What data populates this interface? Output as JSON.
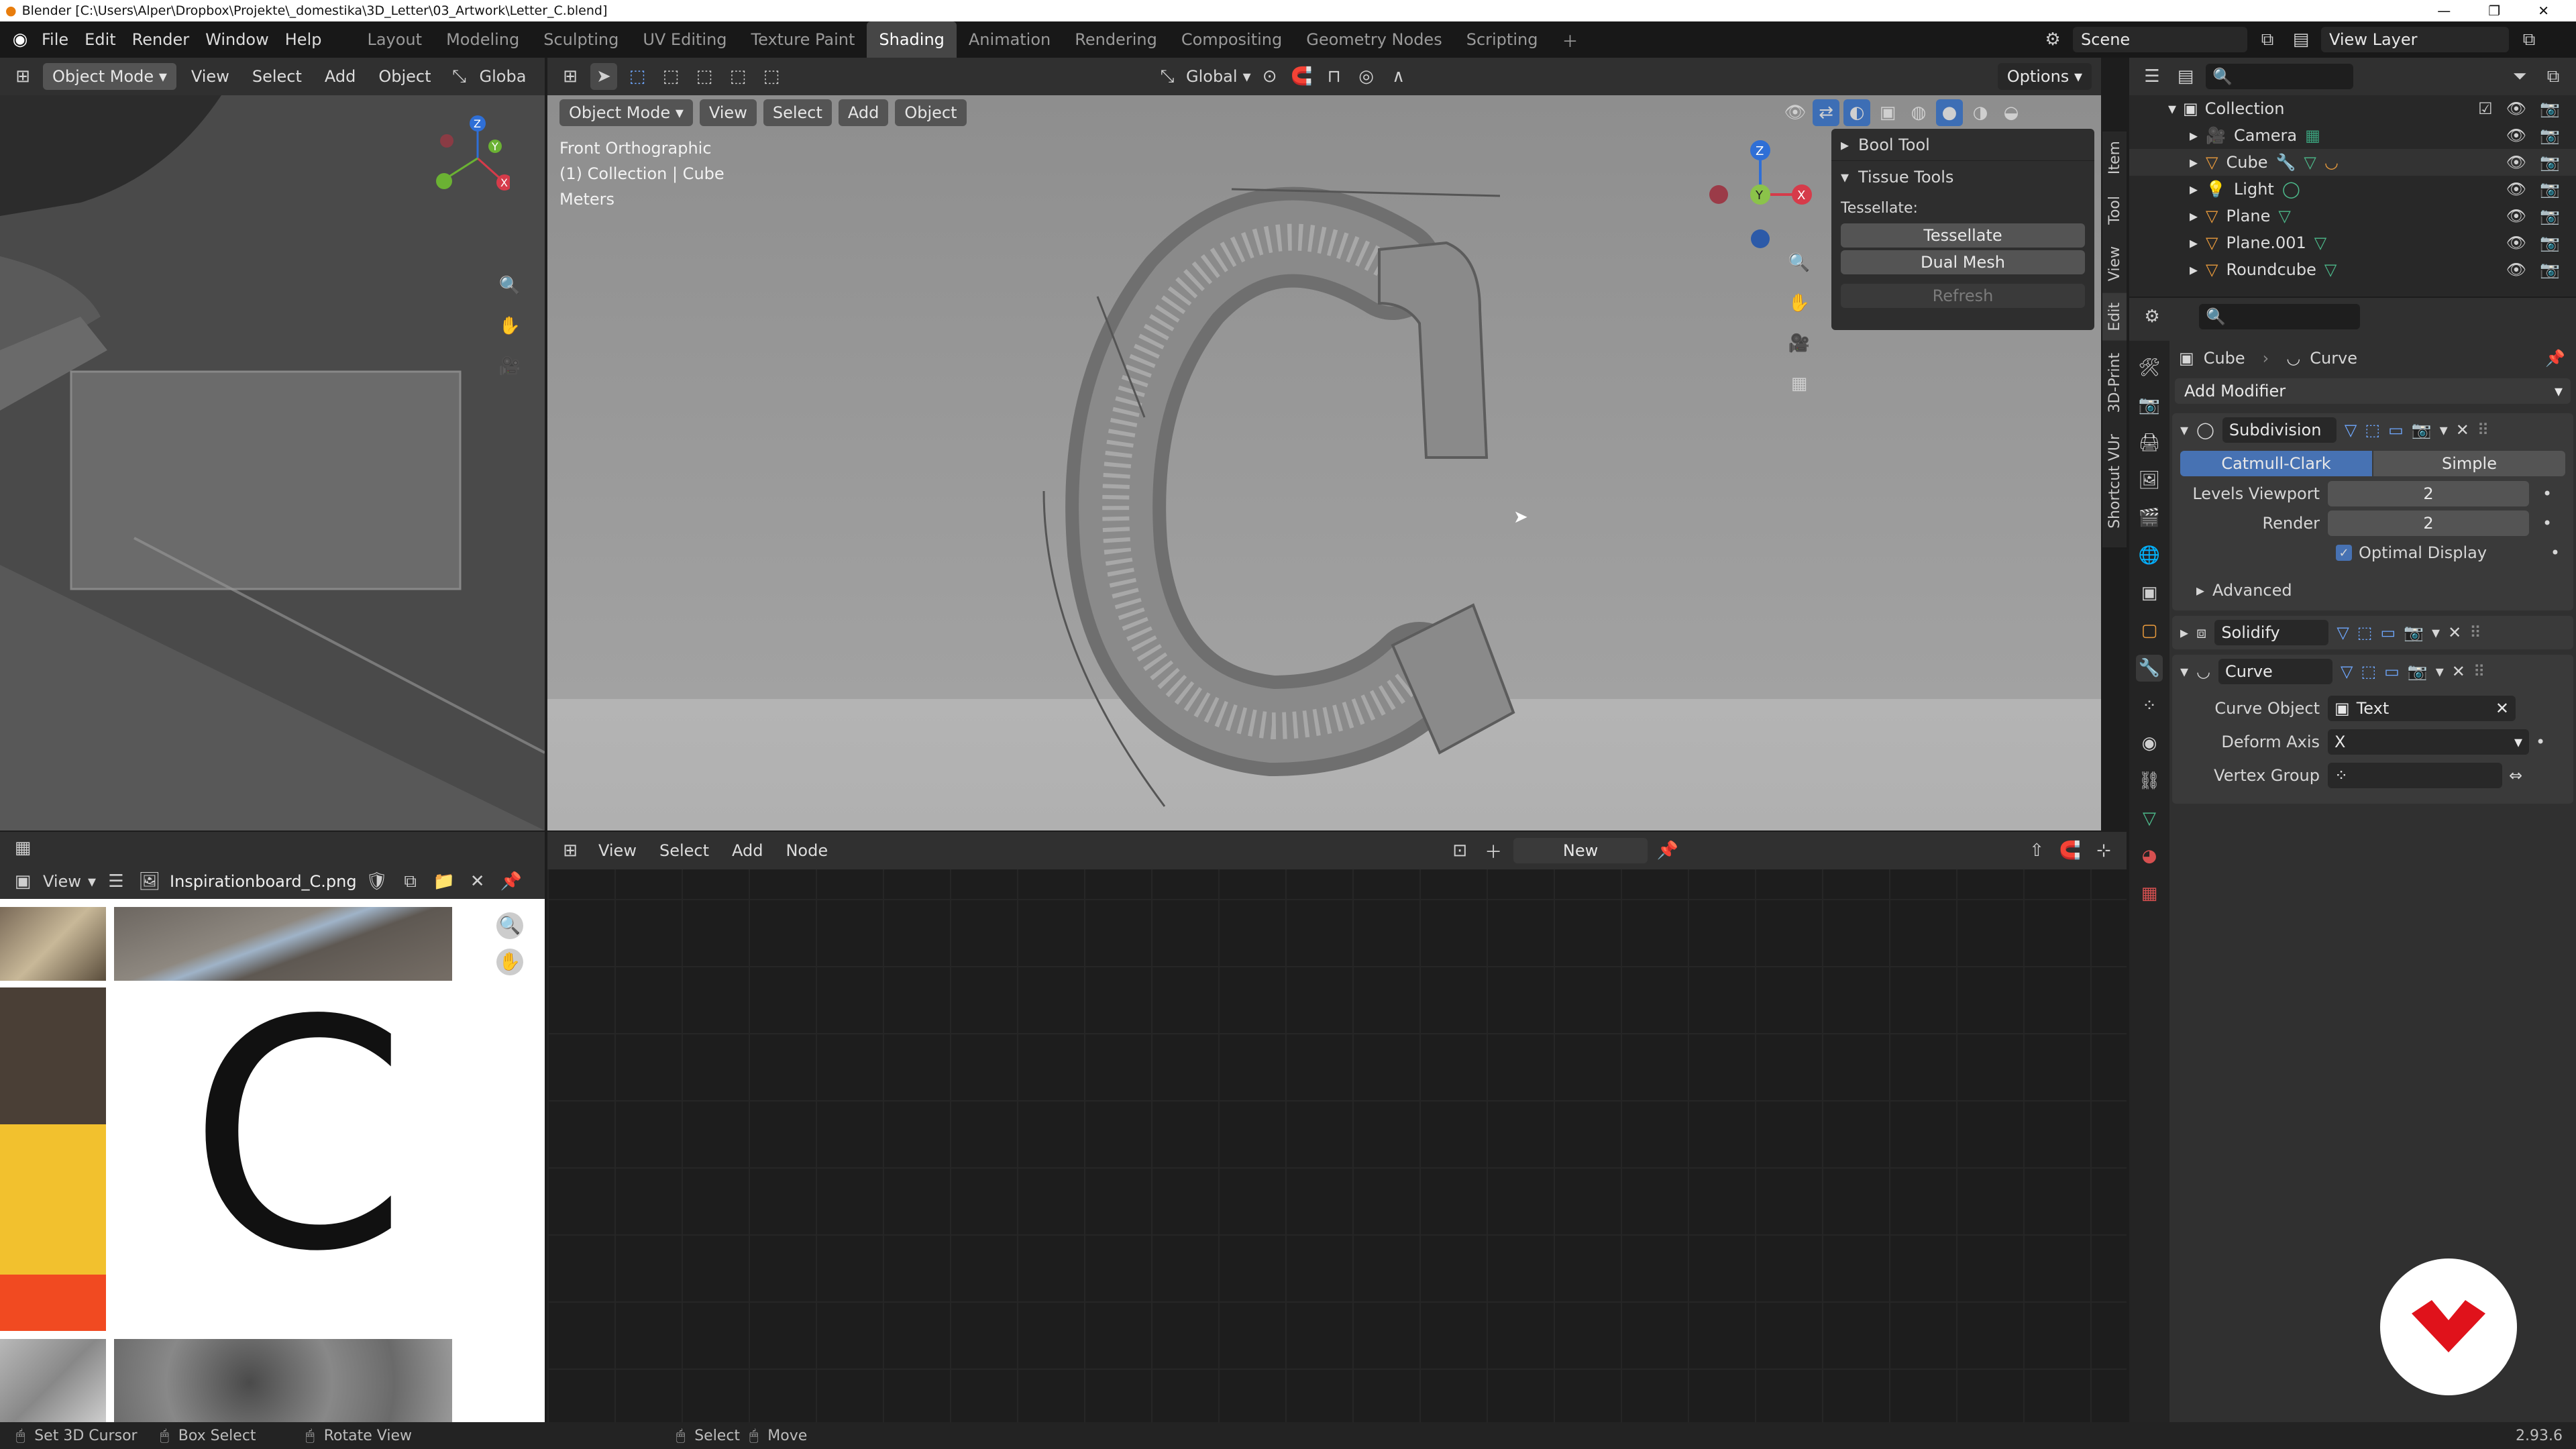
{
  "title_bar": {
    "title": "Blender [C:\\Users\\Alper\\Dropbox\\Projekte\\_domestika\\3D_Letter\\03_Artwork\\Letter_C.blend]",
    "controls": [
      "—",
      "❐",
      "✕"
    ]
  },
  "top_menu": [
    "File",
    "Edit",
    "Render",
    "Window",
    "Help"
  ],
  "workspace_tabs": [
    "Layout",
    "Modeling",
    "Sculpting",
    "UV Editing",
    "Texture Paint",
    "Shading",
    "Animation",
    "Rendering",
    "Compositing",
    "Geometry Nodes",
    "Scripting"
  ],
  "active_workspace": "Shading",
  "scene": {
    "scene_name": "Scene",
    "view_layer": "View Layer"
  },
  "left_viewport": {
    "mode": "Object Mode",
    "menu": [
      "View",
      "Select",
      "Add",
      "Object"
    ],
    "orientation": "Globa"
  },
  "main_viewport": {
    "header_orientation": "Global",
    "options_label": "Options",
    "mode": "Object Mode",
    "menu": [
      "View",
      "Select",
      "Add",
      "Object"
    ],
    "info": [
      "Front Orthographic",
      "(1) Collection | Cube",
      "Meters"
    ],
    "gizmo_axes": {
      "z": "Z",
      "y": "Y",
      "x": "X"
    },
    "side_tabs": [
      "Item",
      "Tool",
      "View",
      "Edit",
      "3D-Print",
      "Shortcut VUr"
    ]
  },
  "n_panel": {
    "bool_tool": "Bool Tool",
    "tissue_tools": "Tissue Tools",
    "tessellate_label": "Tessellate:",
    "tessellate_button": "Tessellate",
    "dual_mesh_button": "Dual Mesh",
    "refresh_button": "Refresh"
  },
  "image_editor": {
    "view_label": "View",
    "image_name": "Inspirationboard_C.png",
    "big_letter": "C",
    "swatches": [
      "#4a3f36",
      "#f2c12e",
      "#f14a21"
    ]
  },
  "node_editor": {
    "menu": [
      "View",
      "Select",
      "Add",
      "Node"
    ],
    "new_button": "New"
  },
  "outliner": {
    "root": "Collection",
    "items": [
      "Camera",
      "Cube",
      "Light",
      "Plane",
      "Plane.001",
      "Roundcube"
    ]
  },
  "properties": {
    "breadcrumb_object": "Cube",
    "breadcrumb_modifier": "Curve",
    "add_modifier": "Add Modifier",
    "subdivision": {
      "name": "Subdivision",
      "catmull": "Catmull-Clark",
      "simple": "Simple",
      "levels_viewport_label": "Levels Viewport",
      "levels_viewport": "2",
      "render_label": "Render",
      "render": "2",
      "optimal_display": "Optimal Display",
      "advanced": "Advanced"
    },
    "solidify": {
      "name": "Solidify"
    },
    "curve": {
      "name": "Curve",
      "curve_object_label": "Curve Object",
      "curve_object": "Text",
      "deform_axis_label": "Deform Axis",
      "deform_axis": "X",
      "vertex_group_label": "Vertex Group"
    }
  },
  "status_bar": {
    "items": [
      "Set 3D Cursor",
      "Box Select",
      "Rotate View",
      "Select",
      "Move"
    ],
    "version": "2.93.6"
  }
}
